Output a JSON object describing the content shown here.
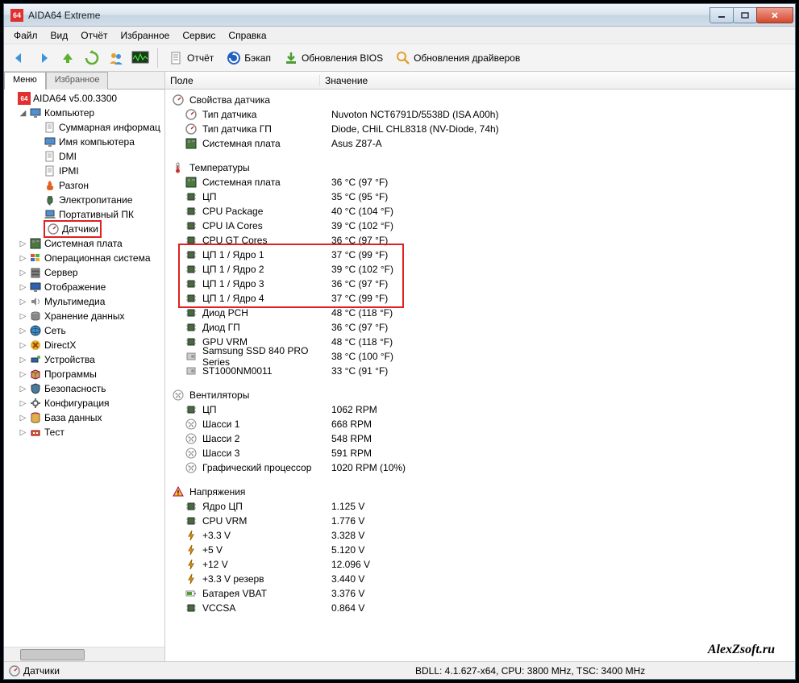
{
  "window": {
    "title": "AIDA64 Extreme",
    "logo_text": "64"
  },
  "menu": [
    "Файл",
    "Вид",
    "Отчёт",
    "Избранное",
    "Сервис",
    "Справка"
  ],
  "toolbar": {
    "report": "Отчёт",
    "backup": "Бэкап",
    "bios_update": "Обновления BIOS",
    "driver_update": "Обновления драйверов"
  },
  "tabs": {
    "menu": "Меню",
    "fav": "Избранное"
  },
  "root": "AIDA64 v5.00.3300",
  "tree": {
    "computer": "Компьютер",
    "computer_children": [
      "Суммарная информац",
      "Имя компьютера",
      "DMI",
      "IPMI",
      "Разгон",
      "Электропитание",
      "Портативный ПК"
    ],
    "sensors": "Датчики",
    "rest": [
      "Системная плата",
      "Операционная система",
      "Сервер",
      "Отображение",
      "Мультимедиа",
      "Хранение данных",
      "Сеть",
      "DirectX",
      "Устройства",
      "Программы",
      "Безопасность",
      "Конфигурация",
      "База данных",
      "Тест"
    ]
  },
  "columns": {
    "field": "Поле",
    "value": "Значение"
  },
  "sections": {
    "props": {
      "title": "Свойства датчика",
      "rows": [
        {
          "f": "Тип датчика",
          "v": "Nuvoton NCT6791D/5538D  (ISA A00h)"
        },
        {
          "f": "Тип датчика ГП",
          "v": "Diode, CHiL CHL8318  (NV-Diode, 74h)"
        },
        {
          "f": "Системная плата",
          "v": "Asus Z87-A"
        }
      ]
    },
    "temps": {
      "title": "Температуры",
      "rows": [
        {
          "f": "Системная плата",
          "v": "36 °C  (97 °F)"
        },
        {
          "f": "ЦП",
          "v": "35 °C  (95 °F)"
        },
        {
          "f": "CPU Package",
          "v": "40 °C  (104 °F)"
        },
        {
          "f": "CPU IA Cores",
          "v": "39 °C  (102 °F)"
        },
        {
          "f": "CPU GT Cores",
          "v": "36 °C  (97 °F)"
        },
        {
          "f": "ЦП 1 / Ядро 1",
          "v": "37 °C  (99 °F)",
          "hl": true
        },
        {
          "f": "ЦП 1 / Ядро 2",
          "v": "39 °C  (102 °F)",
          "hl": true
        },
        {
          "f": "ЦП 1 / Ядро 3",
          "v": "36 °C  (97 °F)",
          "hl": true
        },
        {
          "f": "ЦП 1 / Ядро 4",
          "v": "37 °C  (99 °F)",
          "hl": true
        },
        {
          "f": "Диод PCH",
          "v": "48 °C  (118 °F)"
        },
        {
          "f": "Диод ГП",
          "v": "36 °C  (97 °F)"
        },
        {
          "f": "GPU VRM",
          "v": "48 °C  (118 °F)"
        },
        {
          "f": "Samsung SSD 840 PRO Series",
          "v": "38 °C  (100 °F)"
        },
        {
          "f": "ST1000NM0011",
          "v": "33 °C  (91 °F)"
        }
      ]
    },
    "fans": {
      "title": "Вентиляторы",
      "rows": [
        {
          "f": "ЦП",
          "v": "1062 RPM"
        },
        {
          "f": "Шасси 1",
          "v": "668 RPM"
        },
        {
          "f": "Шасси 2",
          "v": "548 RPM"
        },
        {
          "f": "Шасси 3",
          "v": "591 RPM"
        },
        {
          "f": "Графический процессор",
          "v": "1020 RPM  (10%)"
        }
      ]
    },
    "volts": {
      "title": "Напряжения",
      "rows": [
        {
          "f": "Ядро ЦП",
          "v": "1.125 V"
        },
        {
          "f": "CPU VRM",
          "v": "1.776 V"
        },
        {
          "f": "+3.3 V",
          "v": "3.328 V"
        },
        {
          "f": "+5 V",
          "v": "5.120 V"
        },
        {
          "f": "+12 V",
          "v": "12.096 V"
        },
        {
          "f": "+3.3 V резерв",
          "v": "3.440 V"
        },
        {
          "f": "Батарея VBAT",
          "v": "3.376 V"
        },
        {
          "f": "VCCSA",
          "v": "0.864 V"
        }
      ]
    }
  },
  "status": {
    "left": "Датчики",
    "right": "BDLL: 4.1.627-x64, CPU: 3800 MHz, TSC: 3400 MHz"
  },
  "watermark": "AlexZsoft.ru"
}
